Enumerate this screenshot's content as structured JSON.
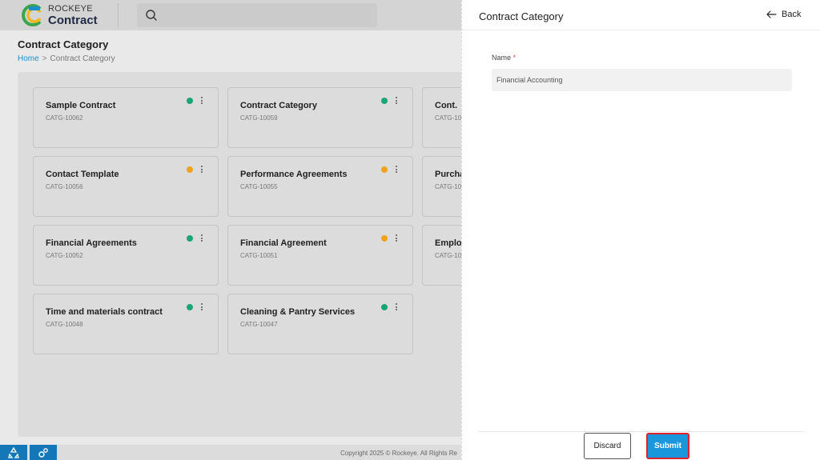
{
  "app": {
    "brand_top": "ROCKEYE",
    "brand_main": "Contract",
    "brand_colors": {
      "navy": "#1f2a44",
      "green": "#3aa54a",
      "yellow": "#f2b71f",
      "blue": "#1a8fc9"
    }
  },
  "header": {
    "search_icon": "search-icon"
  },
  "page": {
    "title": "Contract Category",
    "breadcrumb": {
      "home": "Home",
      "separator": ">",
      "current": "Contract Category"
    }
  },
  "status_colors": {
    "active": "#1aa574",
    "pending": "#f0a21a"
  },
  "cards": [
    {
      "title": "Sample Contract",
      "code": "CATG-10062",
      "status_color": "#1aa574"
    },
    {
      "title": "Contract Category",
      "code": "CATG-10059",
      "status_color": "#1aa574"
    },
    {
      "title": "Cont.",
      "code": "CATG-10",
      "status_color": ""
    },
    {
      "title": "Contact Template",
      "code": "CATG-10056",
      "status_color": "#f0a21a"
    },
    {
      "title": "Performance Agreements",
      "code": "CATG-10055",
      "status_color": "#f0a21a"
    },
    {
      "title": "Purcha",
      "code": "CATG-10",
      "status_color": ""
    },
    {
      "title": "Financial Agreements",
      "code": "CATG-10052",
      "status_color": "#1aa574"
    },
    {
      "title": "Financial Agreement",
      "code": "CATG-10051",
      "status_color": "#f0a21a"
    },
    {
      "title": "Employ",
      "code": "CATG-10",
      "status_color": ""
    },
    {
      "title": "Time and materials contract",
      "code": "CATG-10048",
      "status_color": "#1aa574"
    },
    {
      "title": "Cleaning & Pantry Services",
      "code": "CATG-10047",
      "status_color": "#1aa574"
    }
  ],
  "footer": {
    "copyright": "Copyright 2025 © Rockeye. All Rights Re"
  },
  "drawer": {
    "title": "Contract Category",
    "back_label": "Back",
    "field_label": "Name",
    "required_mark": "*",
    "field_value": "Financial Accounting",
    "discard_label": "Discard",
    "submit_label": "Submit",
    "submit_color": "#1a96dd",
    "submit_highlight": "#e0202a"
  }
}
